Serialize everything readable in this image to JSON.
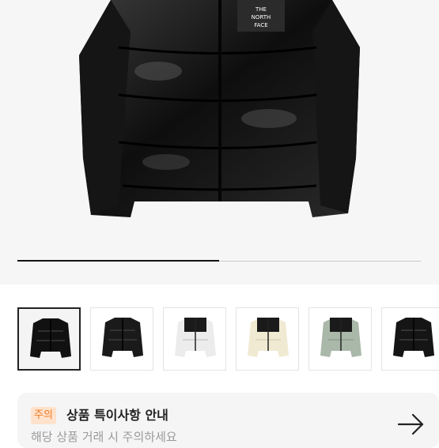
{
  "gallery": {
    "image_alt": "THE NORTH FACE jacket",
    "brand_label": "THE NORTH FACE",
    "progress": 0.5,
    "thumbnails": [
      {
        "name": "black-shiny",
        "selected": true
      },
      {
        "name": "black-matte",
        "selected": false
      },
      {
        "name": "white",
        "selected": false
      },
      {
        "name": "cream",
        "selected": false
      },
      {
        "name": "sage",
        "selected": false
      },
      {
        "name": "black-2",
        "selected": false
      }
    ]
  },
  "notice": {
    "badge": "주의",
    "title": "상품 특이사항 안내",
    "description": "해당 상품 거래 시 주의하세요",
    "arrow_icon": "arrow-right-icon"
  },
  "colors": {
    "accent": "#f07a24",
    "badge_bg": "#ffe2cc"
  }
}
